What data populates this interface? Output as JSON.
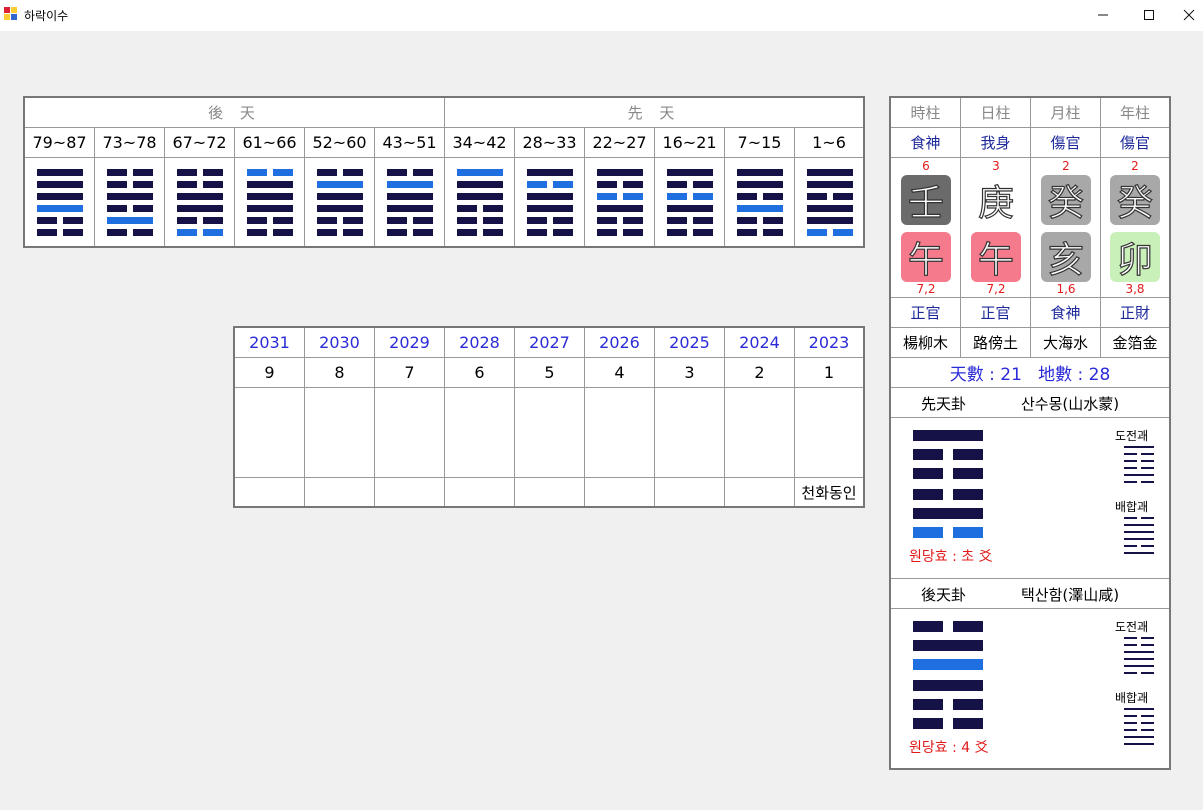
{
  "window": {
    "title": "하락이수",
    "controls": {
      "minimize": "—",
      "maximize": "☐",
      "close": "✕"
    }
  },
  "colors": {
    "changing_line": "#1f6fe0",
    "line": "#151248",
    "red": "#e21a1a",
    "blue_text": "#2b2bd8"
  },
  "main_table": {
    "left_header": "後 天",
    "right_header": "先 天",
    "ranges": [
      "79~87",
      "73~78",
      "67~72",
      "61~66",
      "52~60",
      "43~51",
      "34~42",
      "28~33",
      "22~27",
      "16~21",
      "7~15",
      "1~6"
    ],
    "hexagrams": [
      [
        1,
        1,
        1,
        2,
        0,
        0
      ],
      [
        0,
        0,
        1,
        0,
        2,
        0
      ],
      [
        0,
        0,
        1,
        1,
        0,
        3
      ],
      [
        3,
        1,
        1,
        1,
        0,
        0
      ],
      [
        0,
        2,
        1,
        1,
        0,
        0
      ],
      [
        0,
        2,
        1,
        1,
        0,
        0
      ],
      [
        2,
        1,
        1,
        0,
        0,
        0
      ],
      [
        1,
        3,
        1,
        1,
        0,
        0
      ],
      [
        1,
        0,
        3,
        1,
        0,
        0
      ],
      [
        1,
        0,
        3,
        1,
        0,
        0
      ],
      [
        1,
        1,
        0,
        2,
        0,
        0
      ],
      [
        1,
        1,
        0,
        1,
        1,
        3
      ]
    ]
  },
  "year_table": {
    "years": [
      "2031",
      "2030",
      "2029",
      "2028",
      "2027",
      "2026",
      "2025",
      "2024",
      "2023"
    ],
    "numbers": [
      "9",
      "8",
      "7",
      "6",
      "5",
      "4",
      "3",
      "2",
      "1"
    ],
    "notes": [
      "",
      "",
      "",
      "",
      "",
      "",
      "",
      "",
      "천화동인"
    ]
  },
  "pillars": {
    "headers": [
      "時柱",
      "日柱",
      "月柱",
      "年柱"
    ],
    "top_relations": [
      "食神",
      "我身",
      "傷官",
      "傷官"
    ],
    "top_numbers": [
      "6",
      "3",
      "2",
      "2"
    ],
    "stems": [
      "壬",
      "庚",
      "癸",
      "癸"
    ],
    "branches": [
      "午",
      "午",
      "亥",
      "卯"
    ],
    "stem_colors": [
      "#6b6b6b",
      "#ffffff",
      "#a8a8a8",
      "#a8a8a8"
    ],
    "branch_colors": [
      "#f47a8c",
      "#f47a8c",
      "#a8a8a8",
      "#c9f0b8"
    ],
    "bottom_numbers": [
      "7,2",
      "7,2",
      "1,6",
      "3,8"
    ],
    "bottom_relations": [
      "正官",
      "正官",
      "食神",
      "正財"
    ],
    "nayin": [
      "楊柳木",
      "路傍土",
      "大海水",
      "金箔金"
    ]
  },
  "sums": {
    "text": "天數 : 21   地數 : 28"
  },
  "xiantian": {
    "label": "先天卦",
    "name": "산수몽(山水蒙)",
    "lines": [
      1,
      0,
      0,
      0,
      1,
      3
    ],
    "side1_label": "도전괘",
    "side1_lines": [
      1,
      0,
      0,
      0,
      1,
      0
    ],
    "side2_label": "배합괘",
    "side2_lines": [
      0,
      1,
      1,
      1,
      0,
      1
    ],
    "note": "원당효 : 초 爻"
  },
  "houtian": {
    "label": "後天卦",
    "name": "택산함(澤山咸)",
    "lines": [
      0,
      1,
      2,
      1,
      0,
      0
    ],
    "side1_label": "도전괘",
    "side1_lines": [
      0,
      0,
      1,
      1,
      1,
      0
    ],
    "side2_label": "배합괘",
    "side2_lines": [
      1,
      0,
      0,
      0,
      1,
      1
    ],
    "note": "원당효 : 4 爻"
  }
}
